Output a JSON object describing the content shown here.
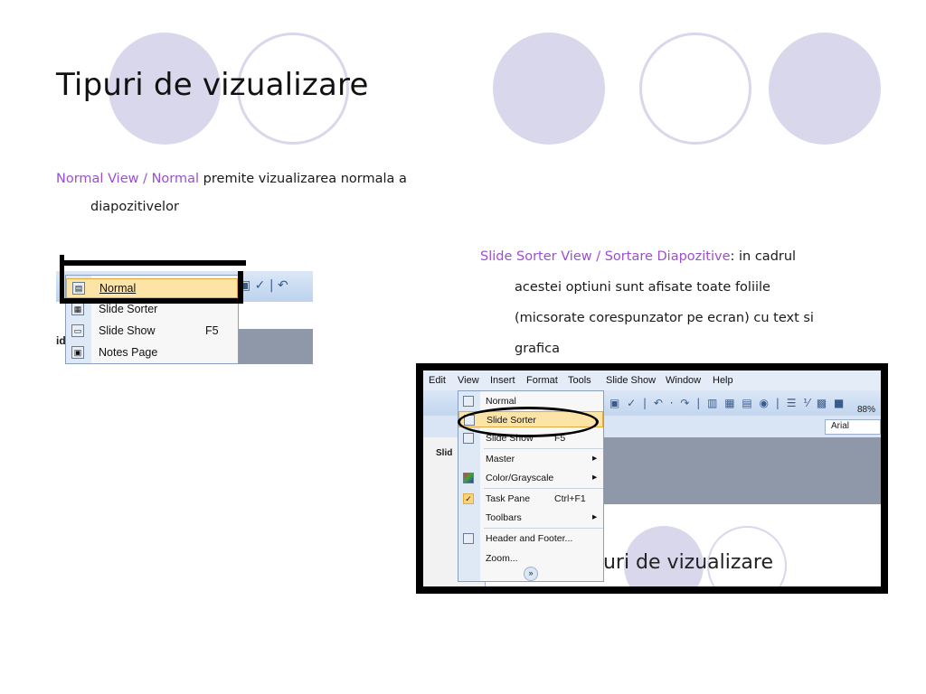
{
  "title": "Tipuri de vizualizare",
  "para1": {
    "highlight": "Normal View / Normal",
    "rest": " premite vizualizarea normala a",
    "line2": "diapozitivelor"
  },
  "para2": {
    "highlight": "Slide Sorter View / Sortare Diapozitive",
    "rest": ": in cadrul",
    "lines": [
      "acestei optiuni sunt afisate toate foliile",
      "(micsorate corespunzator pe ecran) cu text si",
      "grafica"
    ]
  },
  "colors": {
    "highlight": "#9b4fd0",
    "circle": "#d9d7ec",
    "menu_highlight": "#fce3a6"
  },
  "screenshot1": {
    "items": [
      {
        "label": "Normal",
        "shortcut": "",
        "icon": "normal-view-icon"
      },
      {
        "label": "Slide Sorter",
        "shortcut": "",
        "icon": "slide-sorter-icon"
      },
      {
        "label": "Slide Show",
        "shortcut": "F5",
        "icon": "slide-show-icon"
      },
      {
        "label": "Notes Page",
        "shortcut": "",
        "icon": "notes-page-icon"
      }
    ],
    "side_label": "id"
  },
  "screenshot2": {
    "menubar": [
      "Edit",
      "View",
      "Insert",
      "Format",
      "Tools",
      "Slide Show",
      "Window",
      "Help"
    ],
    "menu_items": [
      {
        "label": "Normal",
        "shortcut": ""
      },
      {
        "label": "Slide Sorter",
        "shortcut": ""
      },
      {
        "label": "Slide Show",
        "shortcut": "F5"
      },
      {
        "label": "Master",
        "shortcut": ""
      },
      {
        "label": "Color/Grayscale",
        "shortcut": ""
      },
      {
        "label": "Task Pane",
        "shortcut": "Ctrl+F1"
      },
      {
        "label": "Toolbars",
        "shortcut": ""
      },
      {
        "label": "Header and Footer...",
        "shortcut": ""
      },
      {
        "label": "Zoom...",
        "shortcut": ""
      }
    ],
    "zoom": "88%",
    "font": "Arial",
    "tab_label": "Slid",
    "slide_title_fragment": "puri de vizualizare"
  }
}
